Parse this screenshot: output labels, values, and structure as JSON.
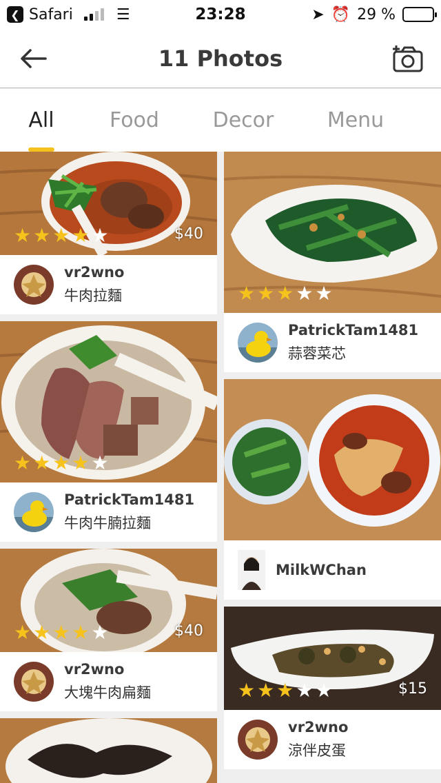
{
  "status": {
    "back_app": "Safari",
    "time": "23:28",
    "battery": "29 %",
    "battery_level": 0.29
  },
  "header": {
    "title": "11 Photos",
    "back_icon": "arrow-left-icon",
    "camera_icon": "add-photo-icon"
  },
  "tabs": [
    {
      "label": "All",
      "active": true
    },
    {
      "label": "Food",
      "active": false
    },
    {
      "label": "Decor",
      "active": false
    },
    {
      "label": "Menu",
      "active": false
    }
  ],
  "colors": {
    "accent": "#f5c11c",
    "star": "#f6c21c"
  },
  "photos_left": [
    {
      "user": "vr2wno",
      "dish": "牛肉拉麵",
      "rating": 4,
      "price": "$40",
      "avatar": "crest"
    },
    {
      "user": "PatrickTam1481",
      "dish": "牛肉牛腩拉麵",
      "rating": 4,
      "price": "",
      "avatar": "duck"
    },
    {
      "user": "vr2wno",
      "dish": "大塊牛肉扁麵",
      "rating": 4,
      "price": "$40",
      "avatar": "crest"
    },
    {
      "user": "",
      "dish": "",
      "rating": 0,
      "price": "",
      "avatar": ""
    }
  ],
  "photos_right": [
    {
      "user": "",
      "dish": "",
      "rating": 3,
      "price": "",
      "avatar": ""
    },
    {
      "user": "PatrickTam1481",
      "dish": "蒜蓉菜芯",
      "rating": 0,
      "price": "",
      "avatar": "duck"
    },
    {
      "user": "MilkWChan",
      "dish": "",
      "rating": 0,
      "price": "",
      "avatar": "person"
    },
    {
      "user": "vr2wno",
      "dish": "涼伴皮蛋",
      "rating": 3,
      "price": "$15",
      "avatar": "crest"
    }
  ]
}
